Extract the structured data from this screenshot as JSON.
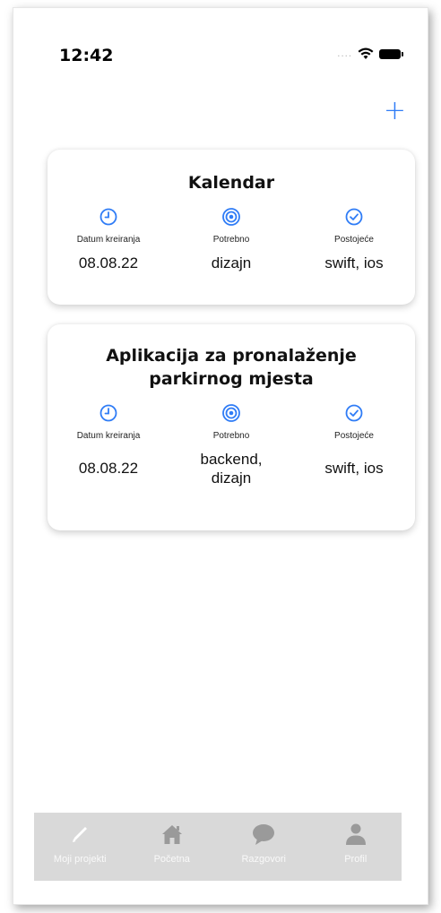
{
  "status_bar": {
    "time": "12:42",
    "signal": "....",
    "wifi_icon": "wifi-icon",
    "battery_icon": "battery-icon"
  },
  "toolbar": {
    "add_label": "+"
  },
  "projects": [
    {
      "title": "Kalendar",
      "created_label": "Datum kreiranja",
      "created_value": "08.08.22",
      "needed_label": "Potrebno",
      "needed_value": "dizajn",
      "existing_label": "Postojeće",
      "existing_value": "swift, ios"
    },
    {
      "title": "Aplikacija za pronalaženje parkirnog mjesta",
      "created_label": "Datum kreiranja",
      "created_value": "08.08.22",
      "needed_label": "Potrebno",
      "needed_value": "backend, dizajn",
      "existing_label": "Postojeće",
      "existing_value": "swift, ios"
    }
  ],
  "tabs": [
    {
      "label": "Moji projekti",
      "icon": "pencil-icon",
      "active": true
    },
    {
      "label": "Početna",
      "icon": "home-icon",
      "active": false
    },
    {
      "label": "Razgovori",
      "icon": "chat-bubble-icon",
      "active": false
    },
    {
      "label": "Profil",
      "icon": "person-icon",
      "active": false
    }
  ],
  "colors": {
    "accent": "#2f7cf6",
    "tab_bar": "#d9d9d9",
    "tab_icon": "#9a9a9a"
  }
}
